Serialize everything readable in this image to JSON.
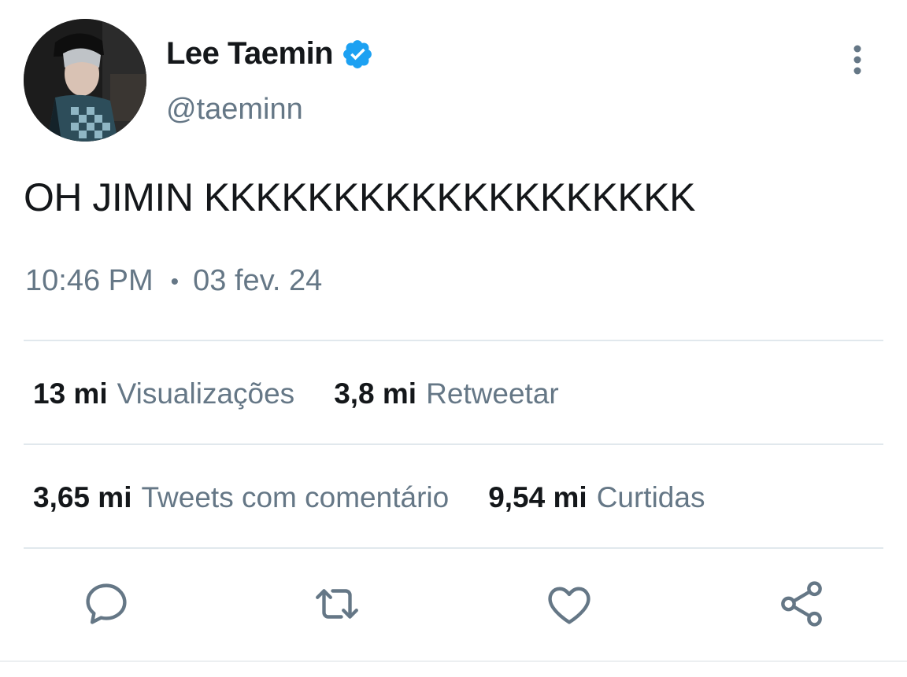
{
  "author": {
    "display_name": "Lee Taemin",
    "handle": "@taeminn",
    "verified_icon": "verified-badge-icon"
  },
  "tweet": {
    "text": "OH JIMIN KKKKKKKKKKKKKKKKKKK",
    "time": "10:46 PM",
    "separator": "•",
    "date": "03 fev. 24"
  },
  "stats": {
    "views_count": "13 mi",
    "views_label": "Visualizações",
    "retweets_count": "3,8 mi",
    "retweets_label": "Retweetar",
    "quotes_count": "3,65 mi",
    "quotes_label": "Tweets com comentário",
    "likes_count": "9,54 mi",
    "likes_label": "Curtidas"
  },
  "actions": [
    "reply-icon",
    "retweet-icon",
    "like-icon",
    "share-icon"
  ],
  "colors": {
    "text": "#14171a",
    "secondary": "#657786",
    "verified": "#1da1f2",
    "divider": "#e1e8ed"
  }
}
